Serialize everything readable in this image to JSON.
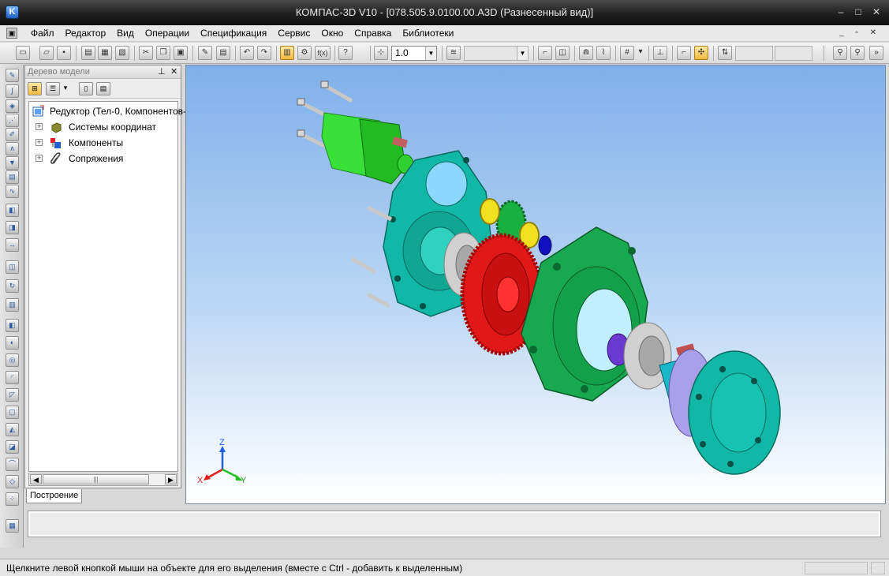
{
  "window": {
    "title": "КОМПАС-3D V10 - [078.505.9.0100.00.A3D (Разнесенный вид)]",
    "app_icon_letter": "K",
    "controls": {
      "minimize": "–",
      "maximize": "□",
      "close": "✕"
    }
  },
  "menu": {
    "items": [
      "Файл",
      "Редактор",
      "Вид",
      "Операции",
      "Спецификация",
      "Сервис",
      "Окно",
      "Справка",
      "Библиотеки"
    ],
    "mdi_controls": "_ ▫ ✕"
  },
  "toolbar": {
    "scale_value": "1.0",
    "layer_value": "",
    "step_x_value": "",
    "step_y_value": "",
    "fx_label": "f(x)"
  },
  "model_tree": {
    "header": "Дерево модели",
    "pin_glyph": "⊥",
    "close_glyph": "✕",
    "root": "Редуктор (Тел-0, Компонентов-",
    "children": [
      "Системы координат",
      "Компоненты",
      "Сопряжения"
    ],
    "expander_glyph": "+",
    "scroll_thumb_glyph": "|||",
    "tab": "Построение"
  },
  "viewport": {
    "axis_labels": {
      "z": "Z",
      "x": "X",
      "y": "Y"
    },
    "colors": {
      "background_top": "#7fb0ea",
      "teal_part": "#12b8a6",
      "green_part": "#18a850",
      "red_gear": "#e01818",
      "motor_green": "#3ee63e",
      "bearing_gray": "#d0d0d0",
      "flange_lilac": "#a8a0e8"
    }
  },
  "status_bar": {
    "message": "Щелкните левой кнопкой мыши на объекте для его выделения (вместе с Ctrl - добавить к выделенным)"
  }
}
